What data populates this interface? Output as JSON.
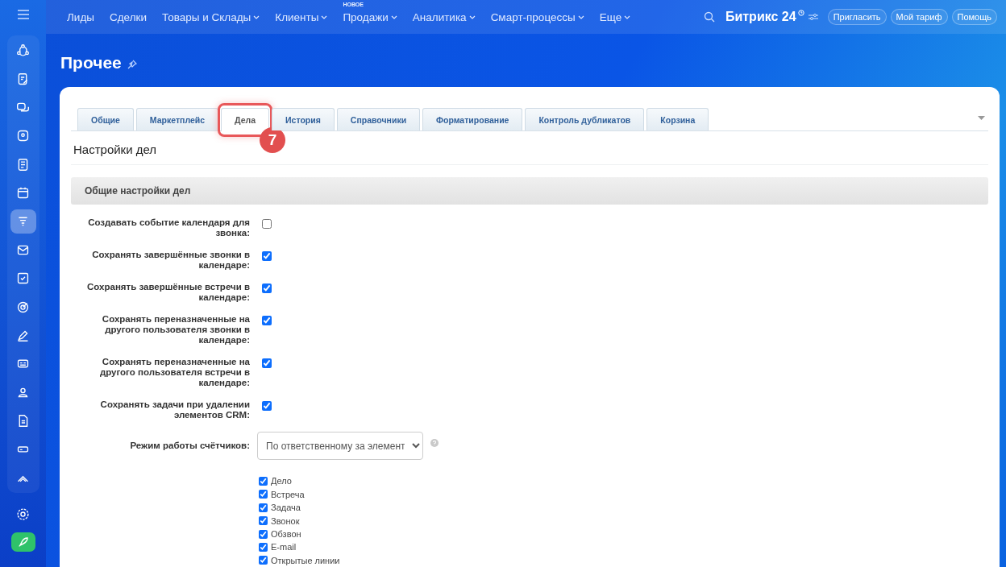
{
  "sidebar": {
    "items": [
      {
        "selected": false
      },
      {
        "selected": false
      },
      {
        "selected": false
      },
      {
        "selected": false
      },
      {
        "selected": false
      },
      {
        "selected": false
      },
      {
        "selected": true
      },
      {
        "selected": false
      },
      {
        "selected": false
      },
      {
        "selected": false
      },
      {
        "selected": false
      },
      {
        "selected": false
      },
      {
        "selected": false
      },
      {
        "selected": false
      },
      {
        "selected": false
      },
      {
        "selected": false
      }
    ]
  },
  "top_nav": {
    "items": [
      {
        "label": "Лиды",
        "dropdown": false
      },
      {
        "label": "Сделки",
        "dropdown": false
      },
      {
        "label": "Товары и Склады",
        "dropdown": true
      },
      {
        "label": "Клиенты",
        "dropdown": true
      },
      {
        "label": "Продажи",
        "dropdown": true,
        "badge": "НОВОЕ"
      },
      {
        "label": "Аналитика",
        "dropdown": true
      },
      {
        "label": "Смарт-процессы",
        "dropdown": true
      },
      {
        "label": "Еще",
        "dropdown": true
      }
    ],
    "logo": "Битрикс 24",
    "buttons": [
      "Пригласить",
      "Мой тариф",
      "Помощь"
    ]
  },
  "page_title": "Прочее",
  "tabs": [
    {
      "label": "Общие",
      "selected": false
    },
    {
      "label": "Маркетплейс",
      "selected": false
    },
    {
      "label": "Дела",
      "selected": true,
      "callout": "7"
    },
    {
      "label": "История",
      "selected": false
    },
    {
      "label": "Справочники",
      "selected": false
    },
    {
      "label": "Форматирование",
      "selected": false
    },
    {
      "label": "Контроль дубликатов",
      "selected": false
    },
    {
      "label": "Корзина",
      "selected": false
    }
  ],
  "heading": "Настройки дел",
  "section": {
    "title": "Общие настройки дел",
    "settings": [
      {
        "label": "Создавать событие календаря для звонка:",
        "checked": false
      },
      {
        "label": "Сохранять завершённые звонки в календаре:",
        "checked": true
      },
      {
        "label": "Сохранять завершённые встречи в календаре:",
        "checked": true
      },
      {
        "label": "Сохранять переназначенные на другого пользователя звонки в календаре:",
        "checked": true
      },
      {
        "label": "Сохранять переназначенные на другого пользователя встречи в календаре:",
        "checked": true
      },
      {
        "label": "Сохранять задачи при удалении элементов CRM:",
        "checked": true
      }
    ],
    "counter_mode": {
      "label": "Режим работы счётчиков:",
      "value": "По ответственному за элемент"
    },
    "activity_types": [
      {
        "label": "Дело",
        "checked": true
      },
      {
        "label": "Встреча",
        "checked": true
      },
      {
        "label": "Задача",
        "checked": true
      },
      {
        "label": "Звонок",
        "checked": true
      },
      {
        "label": "Обзвон",
        "checked": true
      },
      {
        "label": "E-mail",
        "checked": true
      },
      {
        "label": "Открытые линии",
        "checked": true
      }
    ]
  }
}
